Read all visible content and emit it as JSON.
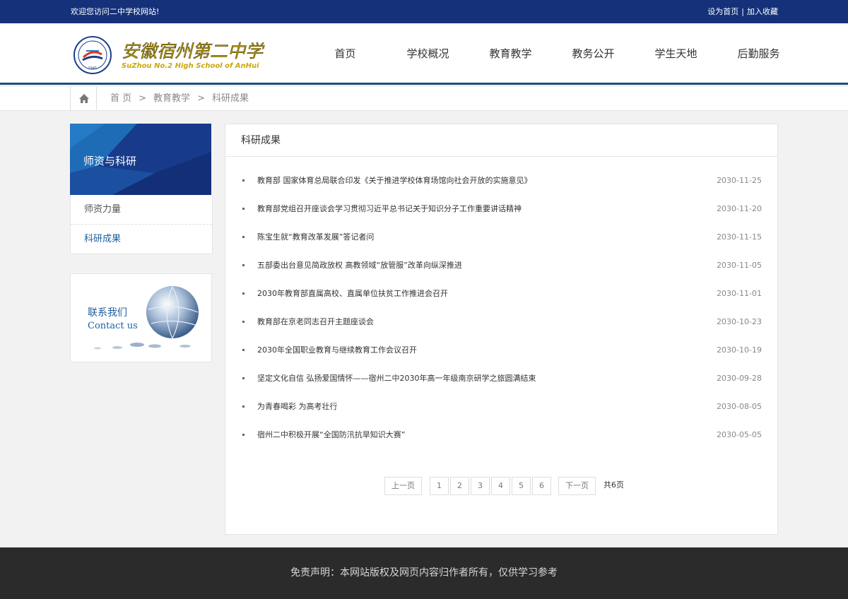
{
  "topbar": {
    "welcome": "欢迎您访问二中学校网站!",
    "set_home": "设为首页",
    "separator": "|",
    "add_favorite": "加入收藏"
  },
  "header": {
    "logo_cn": "安徽宿州第二中学",
    "logo_en": "SuZhou No.2 High School of AnHui",
    "nav": [
      "首页",
      "学校概况",
      "教育教学",
      "教务公开",
      "学生天地",
      "后勤服务"
    ]
  },
  "breadcrumb": {
    "items": [
      "首 页",
      "教育教学",
      "科研成果"
    ],
    "separator": ">"
  },
  "sidebar": {
    "title": "师资与科研",
    "items": [
      {
        "label": "师资力量",
        "active": false
      },
      {
        "label": "科研成果",
        "active": true
      }
    ],
    "contact_cn": "联系我们",
    "contact_en": "Contact us"
  },
  "main": {
    "title": "科研成果",
    "news": [
      {
        "title": "教育部 国家体育总局联合印发《关于推进学校体育场馆向社会开放的实施意见》",
        "date": "2030-11-25"
      },
      {
        "title": "教育部党组召开座谈会学习贯彻习近平总书记关于知识分子工作重要讲话精神",
        "date": "2030-11-20"
      },
      {
        "title": "陈宝生就“教育改革发展”答记者问",
        "date": "2030-11-15"
      },
      {
        "title": "五部委出台意见简政放权 高教领域“放管服”改革向纵深推进",
        "date": "2030-11-05"
      },
      {
        "title": "2030年教育部直属高校、直属单位扶贫工作推进会召开",
        "date": "2030-11-01"
      },
      {
        "title": "教育部在京老同志召开主题座谈会",
        "date": "2030-10-23"
      },
      {
        "title": "2030年全国职业教育与继续教育工作会议召开",
        "date": "2030-10-19"
      },
      {
        "title": "坚定文化自信 弘扬爱国情怀——宿州二中2030年高一年级南京研学之旅圆满结束",
        "date": "2030-09-28"
      },
      {
        "title": "为青春喝彩 为高考壮行",
        "date": "2030-08-05"
      },
      {
        "title": "宿州二中积极开展“全国防汛抗旱知识大赛”",
        "date": "2030-05-05"
      }
    ],
    "pager": {
      "prev": "上一页",
      "pages": [
        "1",
        "2",
        "3",
        "4",
        "5",
        "6"
      ],
      "next": "下一页",
      "total": "共6页"
    }
  },
  "footer": {
    "text": "免责声明：本网站版权及网页内容归作者所有，仅供学习参考"
  },
  "colors": {
    "topbar_bg": "#14317a",
    "accent_blue": "#1c5fa0",
    "header_rule": "#1c4f7d",
    "footer_bg": "#2b2b2b"
  },
  "icons": [
    "home-icon",
    "school-emblem-icon",
    "globe-icon"
  ]
}
